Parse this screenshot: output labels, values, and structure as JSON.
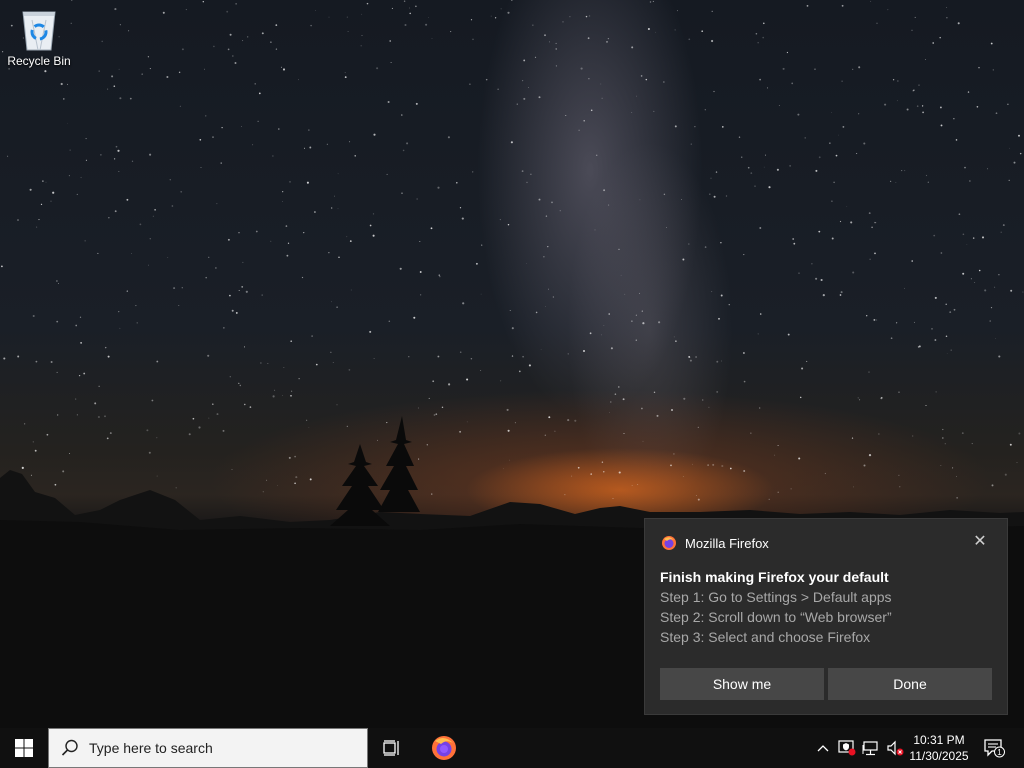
{
  "desktop": {
    "icons": [
      {
        "label": "Recycle Bin",
        "icon": "recycle-bin-icon"
      }
    ]
  },
  "toast": {
    "app_name": "Mozilla Firefox",
    "app_icon": "firefox-icon",
    "title": "Finish making Firefox your default",
    "steps": [
      "Step 1: Go to Settings > Default apps",
      "Step 2: Scroll down to “Web browser”",
      "Step 3: Select and choose Firefox"
    ],
    "buttons": {
      "primary": "Show me",
      "secondary": "Done"
    },
    "close_glyph": "✕"
  },
  "taskbar": {
    "search_placeholder": "Type here to search",
    "pinned": [
      {
        "name": "firefox-icon"
      }
    ],
    "tray": {
      "time": "10:31 PM",
      "date": "11/30/2025",
      "notification_count": "1",
      "icons": [
        "chevron-up-icon",
        "security-icon",
        "network-icon",
        "volume-muted-icon"
      ]
    }
  },
  "colors": {
    "toast_bg": "#2b2b2b",
    "button_bg": "#474747",
    "taskbar_bg": "#101010",
    "step_text": "#a8a8a8"
  }
}
